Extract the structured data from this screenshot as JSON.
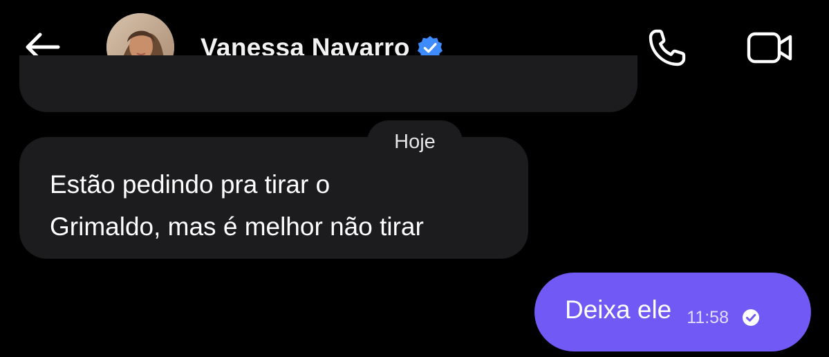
{
  "header": {
    "contact_name": "Vanessa Navarro",
    "verified": true,
    "back_icon": "arrow-left-icon",
    "call_icon": "phone-icon",
    "video_icon": "video-camera-icon",
    "verified_color": "#3d8bff"
  },
  "conversation": {
    "date_separator": "Hoje",
    "messages": [
      {
        "direction": "incoming",
        "text": "Estão pedindo pra tirar o\nGrimaldo, mas é melhor não tirar"
      },
      {
        "direction": "outgoing",
        "text": "Deixa ele",
        "time": "11:58",
        "status_icon": "read-check-icon"
      }
    ]
  },
  "colors": {
    "background": "#000000",
    "incoming_bubble": "#1c1c1e",
    "outgoing_bubble": "#7159f5"
  }
}
